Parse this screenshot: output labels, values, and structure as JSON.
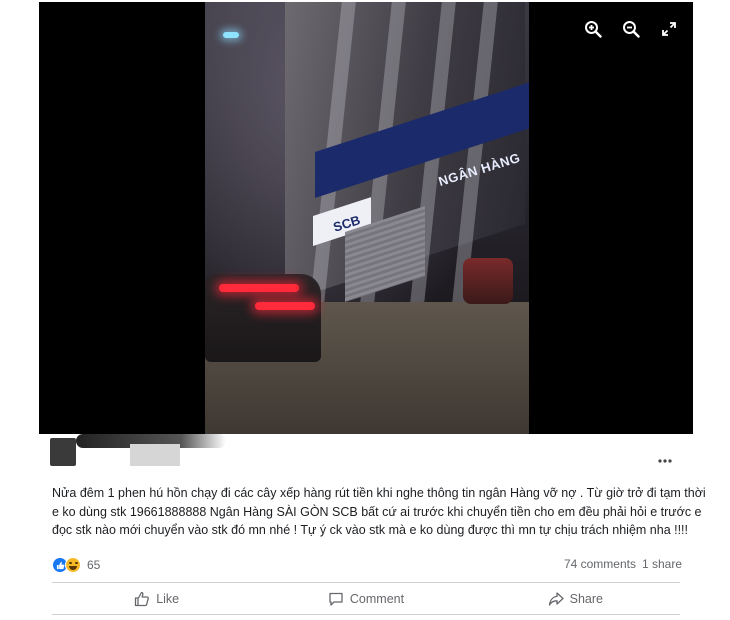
{
  "media": {
    "storefront_sign": "NGÂN HÀNG",
    "bank_logo": "SCB",
    "tools": [
      "zoom-in-icon",
      "zoom-out-icon",
      "fullscreen-icon"
    ]
  },
  "post": {
    "lines": [
      "Nửa đêm 1 phen hú hồn chạy đi các cây xếp hàng rút tiền khi nghe thông tin ngân Hàng vỡ nợ . Từ giờ trở đi tạm thời",
      "e ko dùng stk 19661888888 Ngân Hàng SÀI GÒN SCB bất cứ ai trước khi chuyển tiền cho em đều phải hỏi e trước e",
      "đọc stk nào mới chuyển vào stk đó mn nhé ! Tự ý ck vào stk mà e ko dùng được thì mn tự chịu trách nhiệm nha !!!!"
    ]
  },
  "stats": {
    "reaction_count": "65",
    "comments": "74 comments",
    "shares": "1 share"
  },
  "actions": {
    "like": "Like",
    "comment": "Comment",
    "share": "Share"
  },
  "colors": {
    "facebook_blue": "#1877f2",
    "haha_yellow": "#f7b928",
    "muted_text": "#65676b"
  }
}
